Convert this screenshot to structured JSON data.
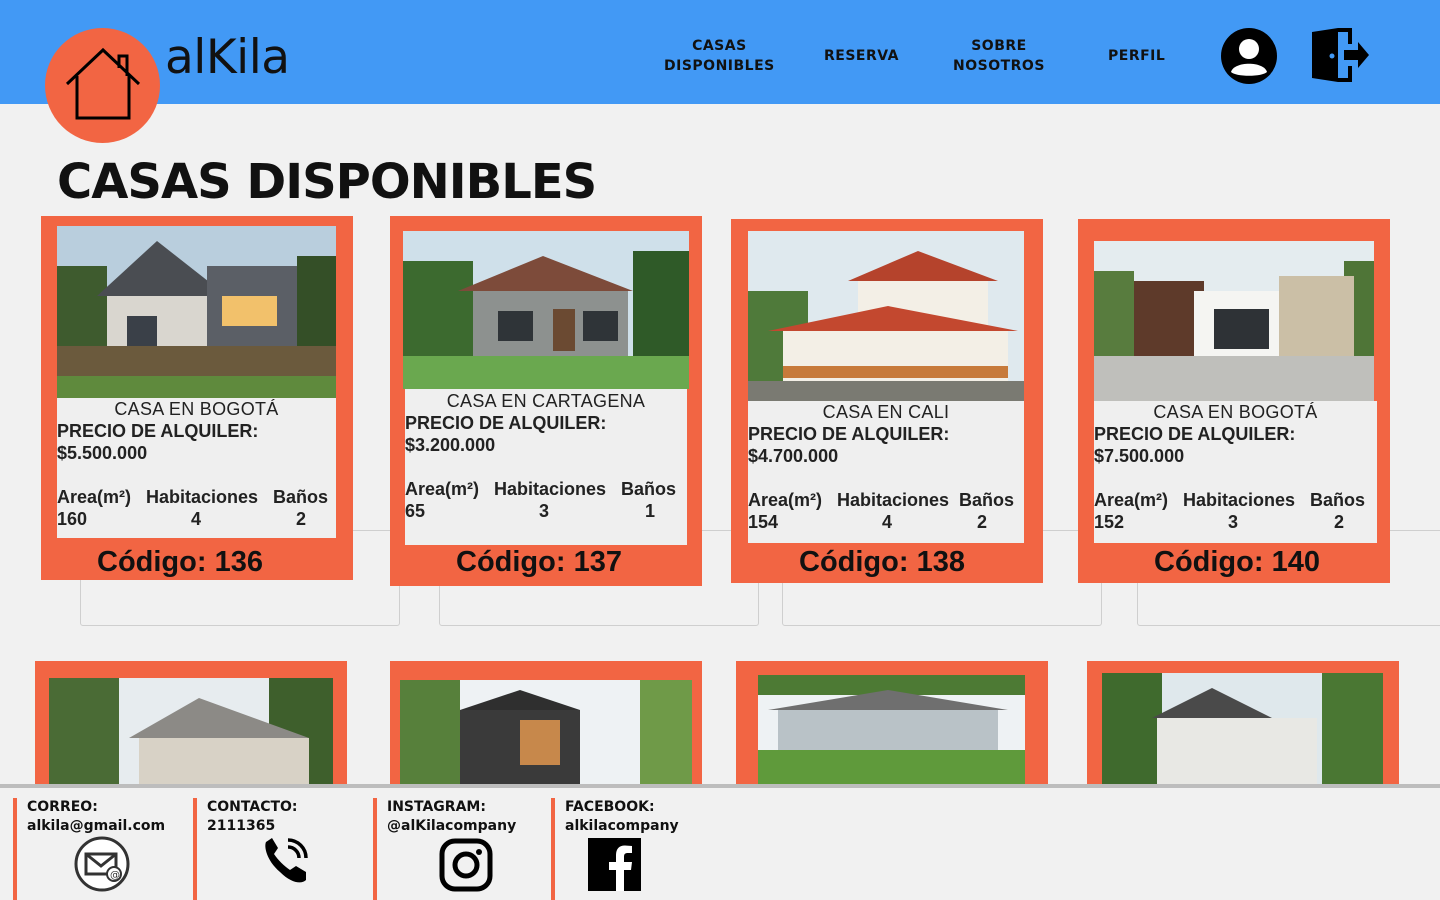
{
  "header": {
    "brand": "alKila",
    "nav": [
      {
        "line1": "CASAS",
        "line2": "DISPONIBLES"
      },
      {
        "line1": "RESERVA"
      },
      {
        "line1": "SOBRE",
        "line2": "NOSOTROS"
      },
      {
        "line1": "PERFIL"
      }
    ],
    "colors": {
      "bar": "#4299f5",
      "accent": "#f26543"
    },
    "icons": [
      "home-icon",
      "user-icon",
      "logout-icon"
    ]
  },
  "main": {
    "title": "CASAS DISPONIBLES",
    "cards": [
      {
        "title": "CASA EN BOGOTÁ",
        "price_label": "PRECIO DE ALQUILER:",
        "price": "$5.500.000",
        "area_label": "Area(m²)",
        "rooms_label": "Habitaciones",
        "baths_label": "Baños",
        "area": "160",
        "rooms": "4",
        "baths": "2",
        "code": "Código: 136"
      },
      {
        "title": "CASA EN CARTAGENA",
        "price_label": "PRECIO DE ALQUILER:",
        "price": "$3.200.000",
        "area_label": "Area(m²)",
        "rooms_label": "Habitaciones",
        "baths_label": "Baños",
        "area": "65",
        "rooms": "3",
        "baths": "1",
        "code": "Código: 137"
      },
      {
        "title": "CASA EN CALI",
        "price_label": "PRECIO DE ALQUILER:",
        "price": "$4.700.000",
        "area_label": "Area(m²)",
        "rooms_label": "Habitaciones",
        "baths_label": "Baños",
        "area": "154",
        "rooms": "4",
        "baths": "2",
        "code": "Código: 138"
      },
      {
        "title": "CASA EN BOGOTÁ",
        "price_label": "PRECIO DE ALQUILER:",
        "price": "$7.500.000",
        "area_label": "Area(m²)",
        "rooms_label": "Habitaciones",
        "baths_label": "Baños",
        "area": "152",
        "rooms": "3",
        "baths": "2",
        "code": "Código: 140"
      }
    ]
  },
  "footer": {
    "email_label": "CORREO:",
    "email": "alkila@gmail.com",
    "phone_label": "CONTACTO:",
    "phone": "2111365",
    "instagram_label": "INSTAGRAM:",
    "instagram": "@alKilacompany",
    "facebook_label": "FACEBOOK:",
    "facebook": "alkilacompany",
    "icons": [
      "mail-icon",
      "phone-icon",
      "instagram-icon",
      "facebook-icon"
    ]
  }
}
